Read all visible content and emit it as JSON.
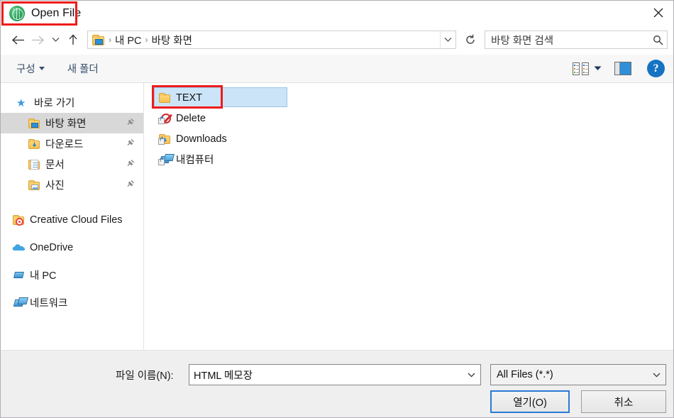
{
  "window": {
    "title": "Open File",
    "app_icon": "green-globe-icon",
    "close_label": "close-icon"
  },
  "navigation": {
    "back": "back-arrow-icon",
    "forward": "forward-arrow-icon",
    "recent": "chevron-down-icon",
    "up": "up-arrow-icon",
    "address_icon": "desktop-folder-icon",
    "breadcrumbs": [
      "내 PC",
      "바탕 화면"
    ],
    "separator": "›",
    "dropdown": "chevron-down-icon",
    "refresh": "refresh-icon"
  },
  "search": {
    "placeholder": "바탕 화면 검색",
    "icon": "search-icon"
  },
  "toolbar": {
    "organize_label": "구성",
    "new_folder_label": "새 폴더",
    "view_icon": "view-options-icon",
    "view_caret": "chevron-down-icon",
    "preview_pane_icon": "preview-pane-icon",
    "help_label": "?"
  },
  "sidebar": {
    "groups": [
      {
        "header": {
          "label": "바로 가기",
          "icon": "star-icon"
        },
        "items": [
          {
            "label": "바탕 화면",
            "icon": "desktop-folder-icon",
            "pinned": true,
            "selected": true
          },
          {
            "label": "다운로드",
            "icon": "downloads-folder-icon",
            "pinned": true,
            "selected": false
          },
          {
            "label": "문서",
            "icon": "documents-folder-icon",
            "pinned": true,
            "selected": false
          },
          {
            "label": "사진",
            "icon": "pictures-folder-icon",
            "pinned": true,
            "selected": false
          }
        ]
      },
      {
        "items": [
          {
            "label": "Creative Cloud Files",
            "icon": "creative-cloud-icon",
            "pinned": false,
            "selected": false
          },
          {
            "label": "OneDrive",
            "icon": "onedrive-cloud-icon",
            "pinned": false,
            "selected": false
          },
          {
            "label": "내 PC",
            "icon": "this-pc-icon",
            "pinned": false,
            "selected": false
          },
          {
            "label": "네트워크",
            "icon": "network-icon",
            "pinned": false,
            "selected": false
          }
        ]
      }
    ],
    "pin_icon": "pin-icon"
  },
  "files": [
    {
      "name": "TEXT",
      "icon": "folder-icon",
      "selected": true,
      "shortcut": false
    },
    {
      "name": "Delete",
      "icon": "shortcut-prohibited-icon",
      "selected": false,
      "shortcut": true
    },
    {
      "name": "Downloads",
      "icon": "downloads-shortcut-icon",
      "selected": false,
      "shortcut": true
    },
    {
      "name": "내컴퓨터",
      "icon": "computer-shortcut-icon",
      "selected": false,
      "shortcut": true
    }
  ],
  "footer": {
    "filename_label": "파일 이름(N):",
    "filename_value": "HTML 메모장",
    "filename_caret": "chevron-down-icon",
    "filetype_value": "All Files (*.*)",
    "filetype_caret": "chevron-down-icon",
    "open_button": "열기(O)",
    "cancel_button": "취소"
  },
  "annotations": {
    "color": "#ee1c1c",
    "boxes": [
      "title-highlight",
      "text-folder-highlight"
    ]
  }
}
